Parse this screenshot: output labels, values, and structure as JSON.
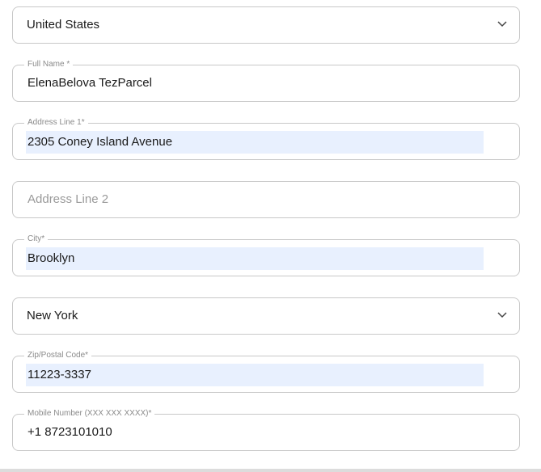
{
  "country": {
    "value": "United States"
  },
  "full_name": {
    "label": "Full Name *",
    "value": "ElenaBelova  TezParcel"
  },
  "address_line_1": {
    "label": "Address Line 1*",
    "value": "2305 Coney Island Avenue"
  },
  "address_line_2": {
    "placeholder": "Address Line 2"
  },
  "city": {
    "label": "City*",
    "value": "Brooklyn"
  },
  "state": {
    "value": "New York"
  },
  "zip": {
    "label": "Zip/Postal Code*",
    "value": "11223-3337"
  },
  "mobile": {
    "label": "Mobile Number (XXX XXX XXXX)*",
    "value": "+1  8723101010"
  },
  "colors": {
    "border": "#c8c8c8",
    "autofill_bg": "#e8f0fe",
    "label_text": "#8a8a8a",
    "value_text": "#1a1a1a",
    "placeholder_text": "#9a9a9a"
  }
}
